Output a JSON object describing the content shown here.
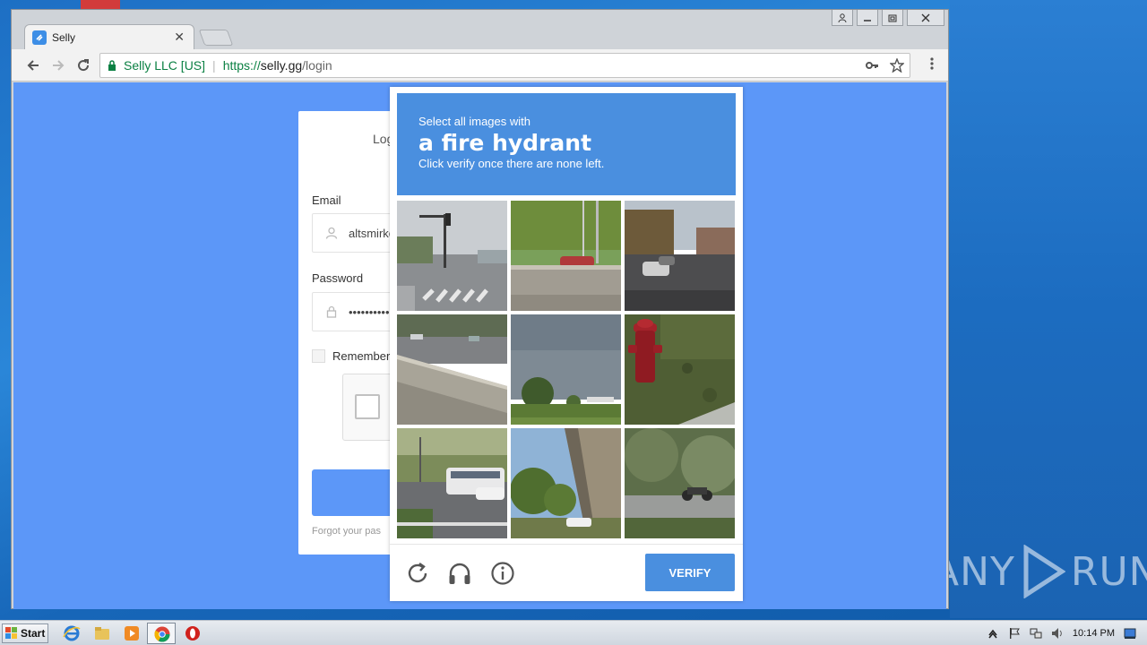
{
  "browser": {
    "tab_title": "Selly",
    "address": {
      "org": "Selly LLC [US]",
      "scheme": "https://",
      "host": "selly.gg",
      "path": "/login"
    }
  },
  "login_card": {
    "title": "Log",
    "email_label": "Email",
    "email_value": "altsmirko",
    "password_label": "Password",
    "password_value": "••••••••••",
    "remember_label": "Remember",
    "forgot_text": "Forgot your pas"
  },
  "captcha": {
    "prompt_pre": "Select all images with",
    "prompt_target": "a fire hydrant",
    "prompt_post": "Click verify once there are none left.",
    "verify_label": "VERIFY",
    "tiles": [
      "street-crosswalk",
      "car-behind-wall",
      "residential-street",
      "highway-barrier",
      "park-trees",
      "fire-hydrant-grass",
      "bus-parking-lot",
      "overpass-trees",
      "motorcycle-trees"
    ]
  },
  "taskbar": {
    "start_label": "Start",
    "clock": "10:14 PM"
  },
  "watermark": {
    "left": "ANY",
    "right": "RUN"
  },
  "colors": {
    "page_bg": "#5c97f8",
    "captcha_accent": "#4a8fdf",
    "secure_green": "#0b8043"
  }
}
